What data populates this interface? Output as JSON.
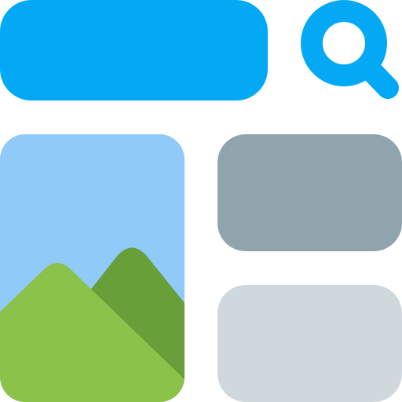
{
  "icon": {
    "name": "image-search-layout-icon",
    "parts": {
      "search_bar": "search-bar",
      "search_icon": "magnifier-icon",
      "image_card": "image-thumbnail",
      "card_primary": "content-card",
      "card_secondary": "content-card"
    }
  },
  "colors": {
    "search_blue": "#03A9F4",
    "sky": "#90CAF9",
    "mountain_light": "#8BC34A",
    "mountain_dark": "#689F38",
    "card_dark": "#90A4AE",
    "card_light": "#CFD8DC",
    "background": "#FFFFFF"
  }
}
